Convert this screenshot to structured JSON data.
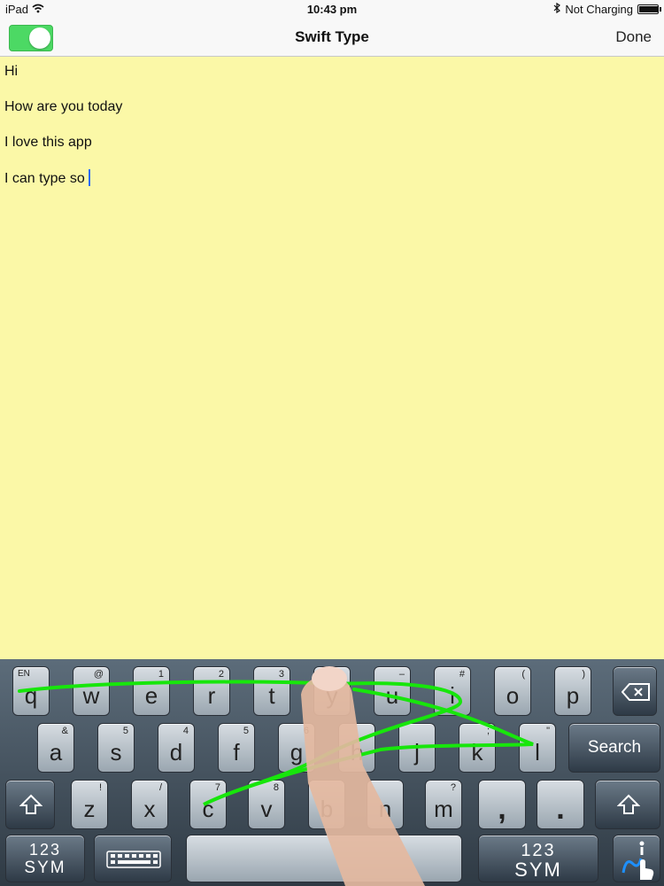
{
  "status": {
    "device": "iPad",
    "time": "10:43 pm",
    "charging": "Not Charging",
    "battery_level": 0.95
  },
  "navbar": {
    "title": "Swift Type",
    "done_label": "Done",
    "toggle_on": true
  },
  "editor": {
    "lines": [
      "Hi",
      "How are you today",
      "I love this app",
      "I can type so"
    ]
  },
  "keyboard": {
    "language": "EN",
    "row1": [
      {
        "main": "q",
        "sub": ""
      },
      {
        "main": "w",
        "sub": "@"
      },
      {
        "main": "e",
        "sub": "1"
      },
      {
        "main": "r",
        "sub": "2"
      },
      {
        "main": "t",
        "sub": "3"
      },
      {
        "main": "y",
        "sub": ""
      },
      {
        "main": "u",
        "sub": "–"
      },
      {
        "main": "i",
        "sub": "#"
      },
      {
        "main": "o",
        "sub": "("
      },
      {
        "main": "p",
        "sub": ")"
      }
    ],
    "row2": [
      {
        "main": "a",
        "sub": "&"
      },
      {
        "main": "s",
        "sub": "5"
      },
      {
        "main": "d",
        "sub": "4"
      },
      {
        "main": "f",
        "sub": "5"
      },
      {
        "main": "g",
        "sub": "6"
      },
      {
        "main": "h",
        "sub": ""
      },
      {
        "main": "j",
        "sub": ""
      },
      {
        "main": "k",
        "sub": ";"
      },
      {
        "main": "l",
        "sub": "\""
      }
    ],
    "row3": [
      {
        "main": "z",
        "sub": "!"
      },
      {
        "main": "x",
        "sub": "/"
      },
      {
        "main": "c",
        "sub": "7"
      },
      {
        "main": "v",
        "sub": "8"
      },
      {
        "main": "b",
        "sub": ""
      },
      {
        "main": "n",
        "sub": ""
      },
      {
        "main": "m",
        "sub": "?"
      },
      {
        "main": ",",
        "sub": ""
      },
      {
        "main": ".",
        "sub": ""
      }
    ],
    "search_label": "Search",
    "sym_line1": "123",
    "sym_line2": "SYM"
  },
  "icons": {
    "battery": "battery-icon",
    "wifi": "wifi-icon",
    "bluetooth": "bluetooth-icon",
    "backspace": "backspace-icon",
    "shift": "shift-icon",
    "keyboard": "keyboard-icon",
    "swype": "swype-info-icon"
  },
  "colors": {
    "editor_bg": "#fbf8a7",
    "toggle": "#4cd964",
    "swipe": "#17e60b"
  }
}
